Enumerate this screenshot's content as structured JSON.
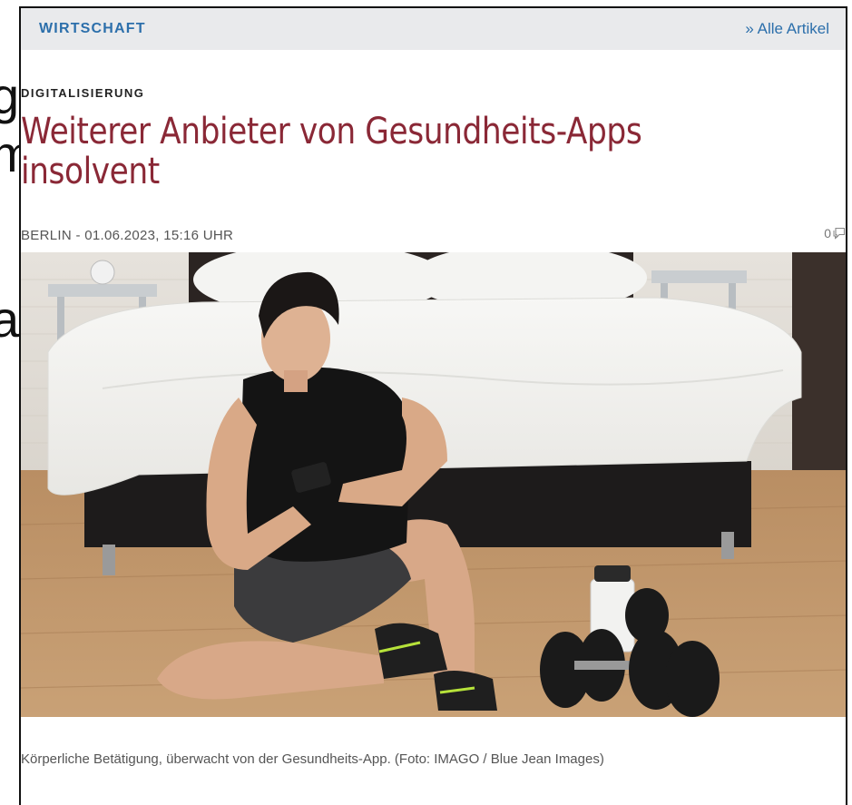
{
  "background_fragments": [
    "gs",
    "m",
    "a"
  ],
  "section": {
    "label": "WIRTSCHAFT",
    "all_articles_link": "» Alle Artikel"
  },
  "article": {
    "kicker": "DIGITALISIERUNG",
    "headline_line1": "Weiterer Anbieter von Gesundheits-Apps",
    "headline_line2": "insolvent",
    "meta": "BERLIN - 01.06.2023, 15:16 UHR",
    "comment_count": "0",
    "comment_icon": "speech-bubble-icon",
    "image_caption": "Körperliche Betätigung, überwacht von der Gesundheits-App. (Foto: IMAGO / Blue Jean Images)"
  },
  "colors": {
    "section_blue": "#2c6fab",
    "headline_red": "#8a2836",
    "topbar_bg": "#e9eaec"
  }
}
